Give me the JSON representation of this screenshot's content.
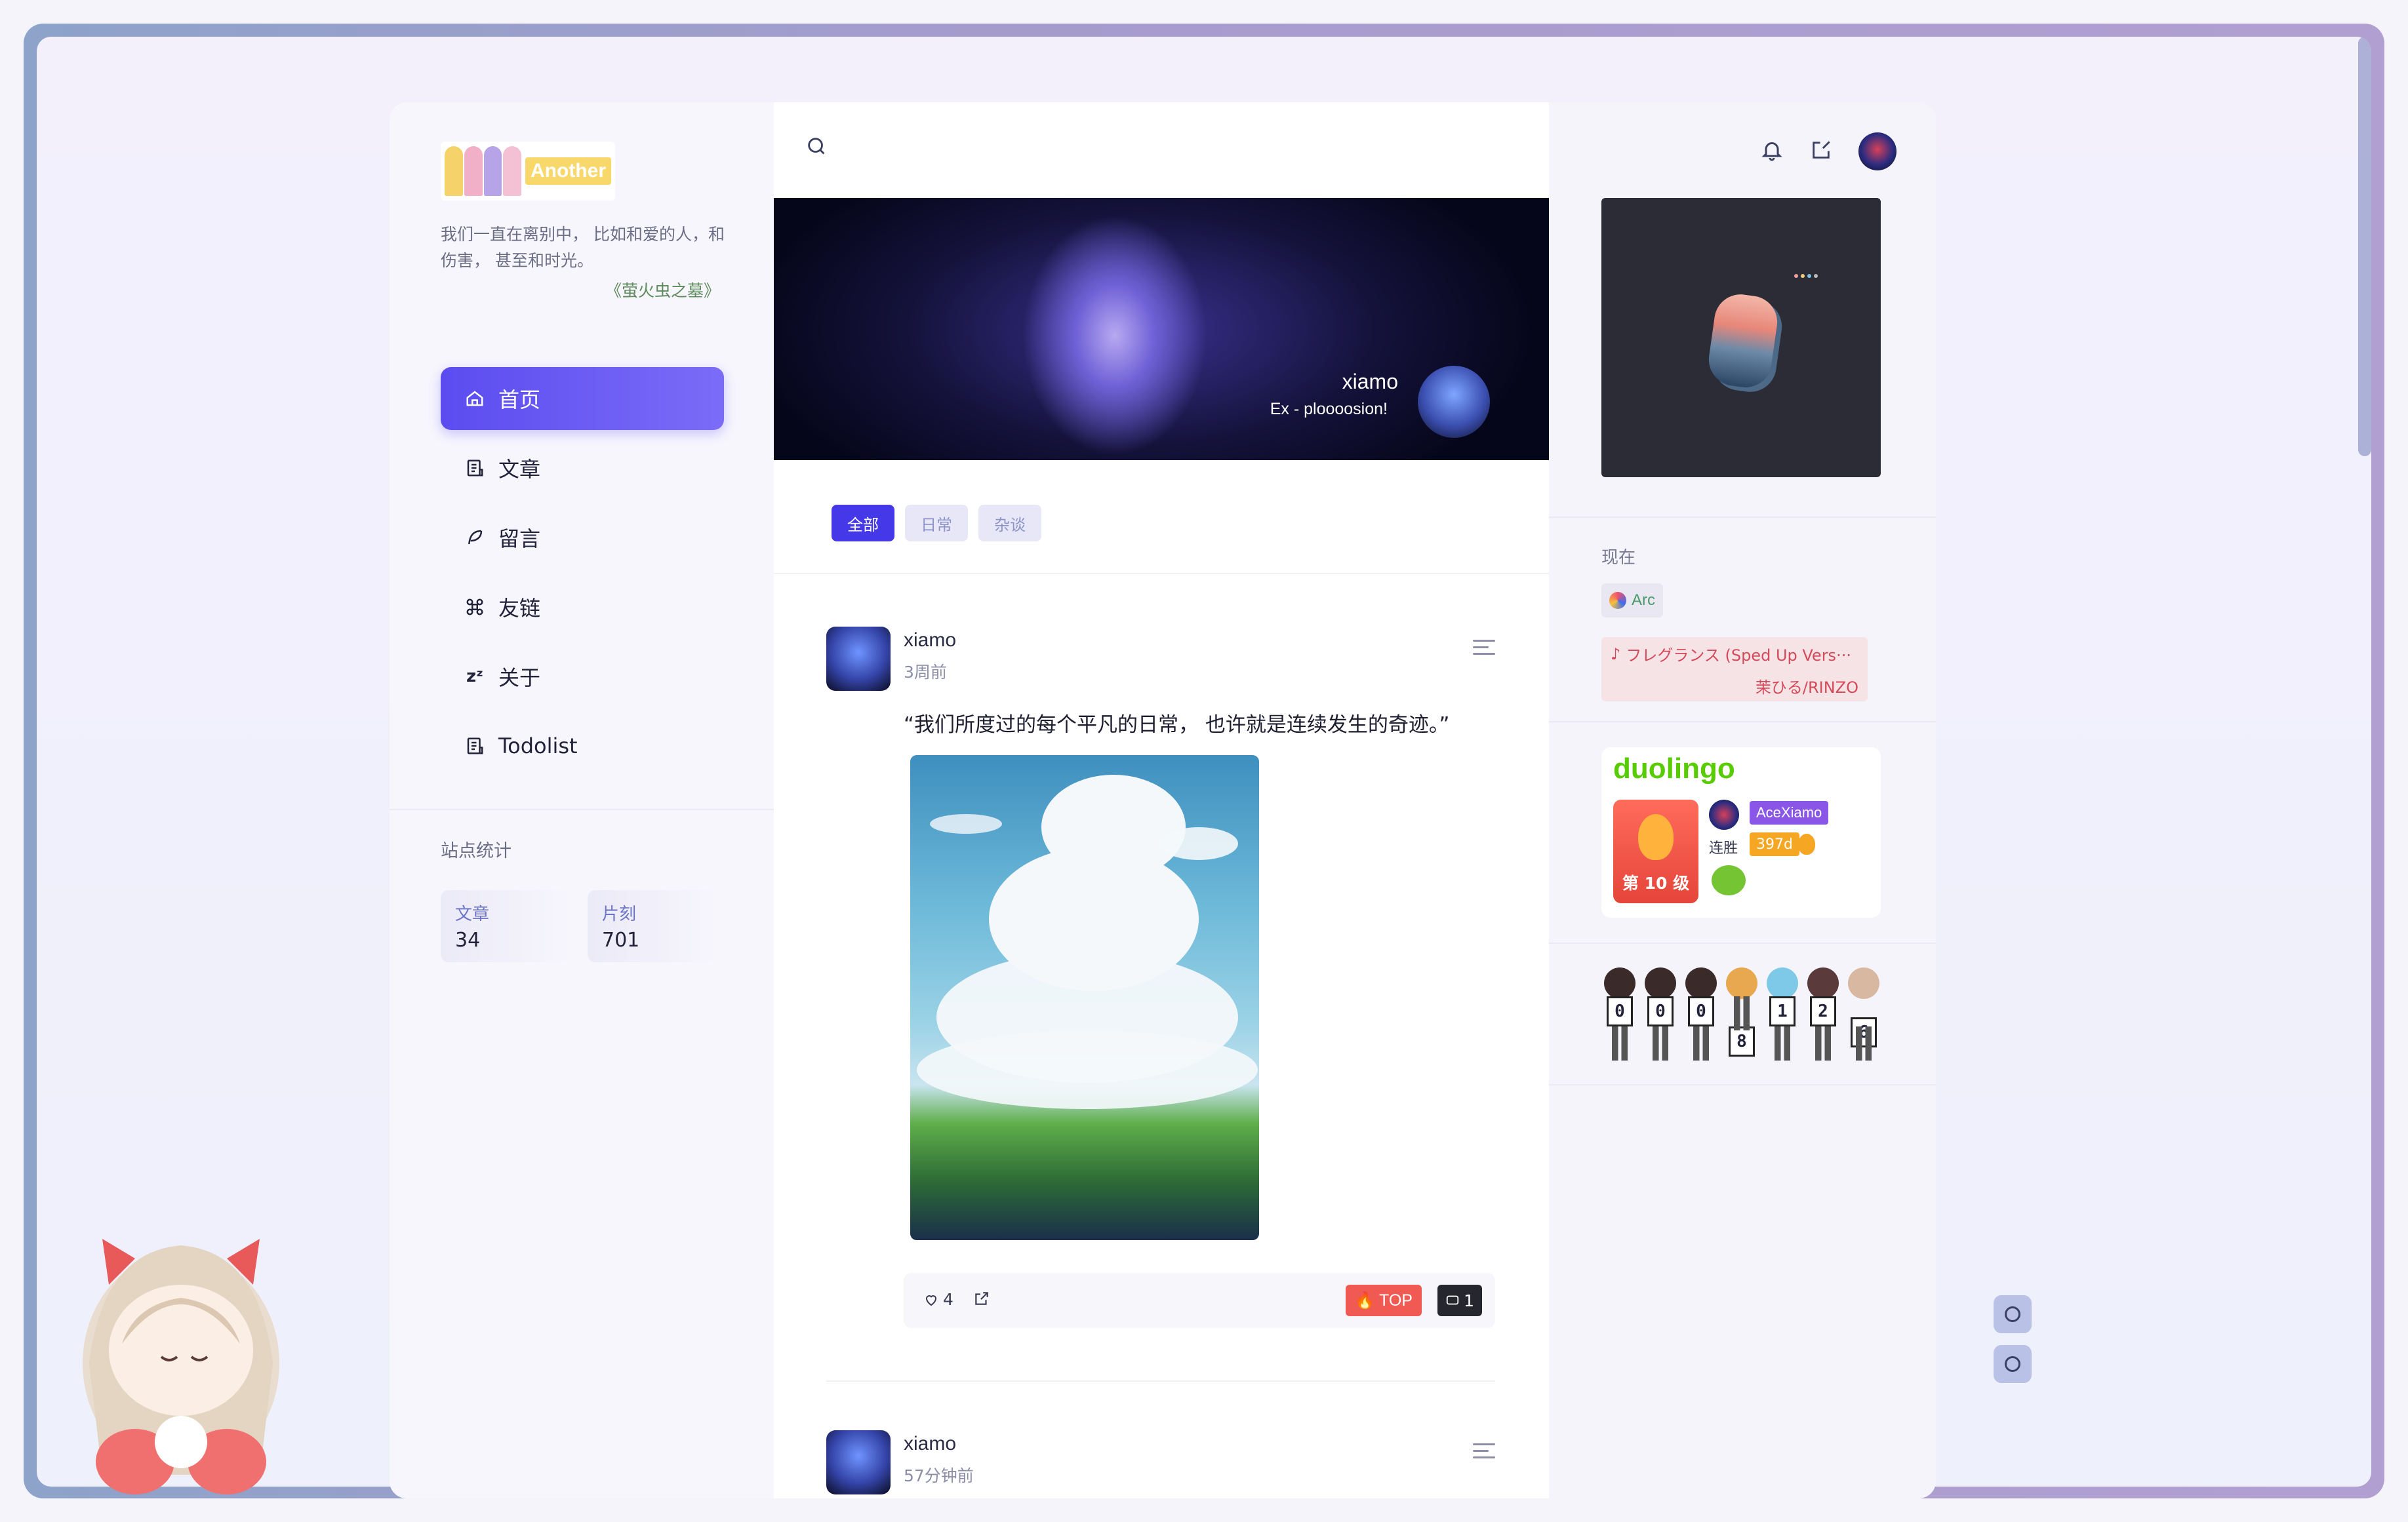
{
  "site": {
    "logo_word": "Another",
    "quote": "我们一直在离别中， 比如和爱的人，和伤害， 甚至和时光。",
    "quote_source": "《萤火虫之墓》"
  },
  "nav": {
    "items": [
      {
        "label": "首页",
        "icon": "home-icon",
        "active": true
      },
      {
        "label": "文章",
        "icon": "document-icon",
        "active": false
      },
      {
        "label": "留言",
        "icon": "feather-icon",
        "active": false
      },
      {
        "label": "友链",
        "icon": "command-icon",
        "active": false
      },
      {
        "label": "关于",
        "icon": "sleep-icon",
        "active": false
      },
      {
        "label": "Todolist",
        "icon": "document-icon",
        "active": false
      }
    ]
  },
  "stats": {
    "title": "站点统计",
    "items": [
      {
        "label": "文章",
        "value": "34"
      },
      {
        "label": "片刻",
        "value": "701"
      }
    ]
  },
  "banner": {
    "name": "xiamo",
    "subtitle": "Ex - ploooosion!"
  },
  "filters": [
    {
      "label": "全部",
      "active": true
    },
    {
      "label": "日常",
      "active": false
    },
    {
      "label": "杂谈",
      "active": false
    }
  ],
  "posts": [
    {
      "author": "xiamo",
      "time": "3周前",
      "text": "“我们所度过的每个平凡的日常， 也许就是连续发生的奇迹。”",
      "likes": "4",
      "top_label": "TOP",
      "comments": "1"
    },
    {
      "author": "xiamo",
      "time": "57分钟前"
    }
  ],
  "sidebar_right": {
    "now_label": "现在",
    "app": "Arc",
    "music_title": "フレグランス (Sped Up Vers···",
    "music_artist": "茉ひる/RINZO",
    "duolingo": {
      "logo": "duolingo",
      "level": "第 10 级",
      "username": "AceXiamo",
      "streak_label": "连胜",
      "streak": "397d"
    },
    "counter_digits": [
      "0",
      "0",
      "0",
      "8",
      "1",
      "2",
      "6"
    ]
  },
  "colors": {
    "accent": "#5b4cf0",
    "top_badge": "#f05a52",
    "duolingo_green": "#58cc02",
    "music": "#d44a5a"
  }
}
